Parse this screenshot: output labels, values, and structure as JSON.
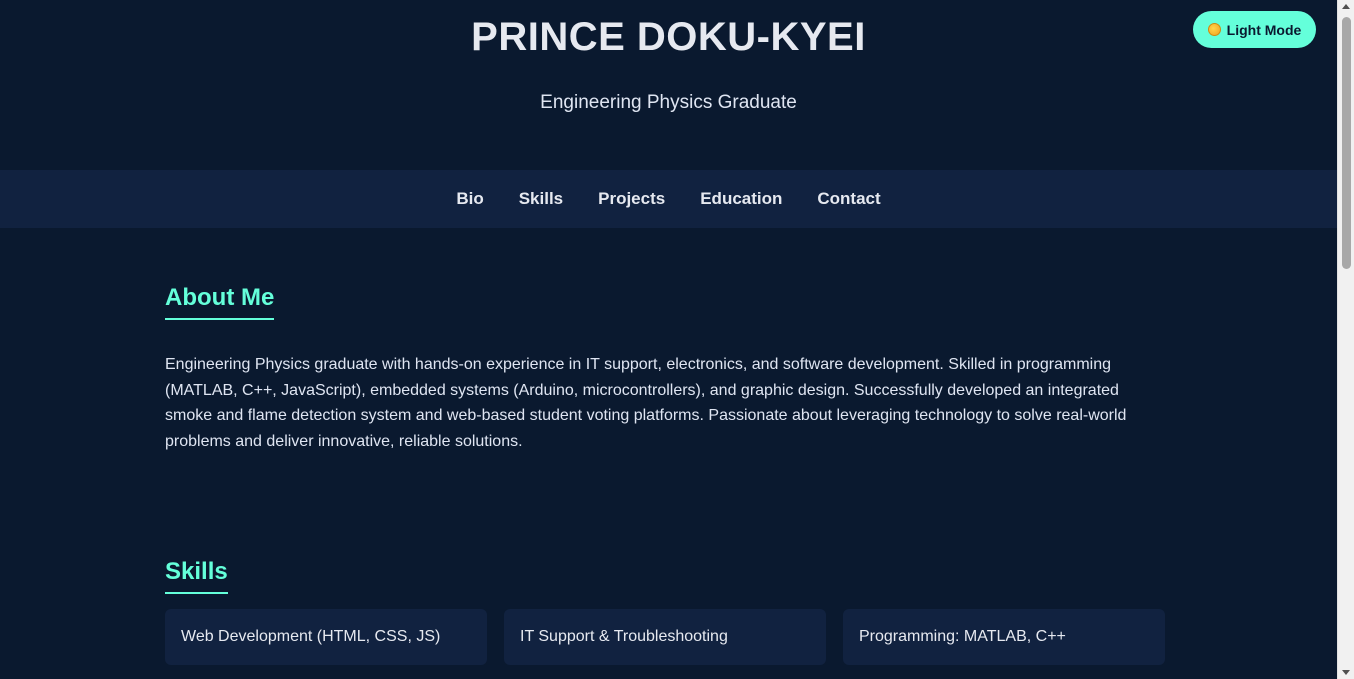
{
  "header": {
    "name": "PRINCE DOKU-KYEI",
    "tagline": "Engineering Physics Graduate",
    "theme_toggle_label": "Light Mode",
    "theme_toggle_icon": "sun-icon"
  },
  "nav": {
    "items": [
      "Bio",
      "Skills",
      "Projects",
      "Education",
      "Contact"
    ]
  },
  "about": {
    "title": "About Me",
    "text": "Engineering Physics graduate with hands-on experience in IT support, electronics, and software development. Skilled in programming (MATLAB, C++, JavaScript), embedded systems (Arduino, microcontrollers), and graphic design. Successfully developed an integrated smoke and flame detection system and web-based student voting platforms. Passionate about leveraging technology to solve real-world problems and deliver innovative, reliable solutions."
  },
  "skills": {
    "title": "Skills",
    "items": [
      "Web Development (HTML, CSS, JS)",
      "IT Support & Troubleshooting",
      "Programming: MATLAB, C++"
    ]
  },
  "colors": {
    "background": "#0a192f",
    "nav_background": "#112240",
    "accent": "#64ffda",
    "text": "#e6e9f0"
  }
}
